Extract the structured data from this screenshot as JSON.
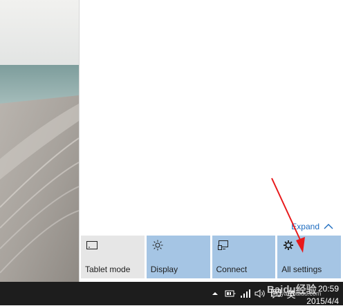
{
  "action_center": {
    "expand_label": "Expand",
    "tiles": [
      {
        "label": "Tablet mode",
        "icon": "tablet-mode-icon",
        "state": "off"
      },
      {
        "label": "Display",
        "icon": "brightness-icon",
        "state": "on"
      },
      {
        "label": "Connect",
        "icon": "connect-icon",
        "state": "on"
      },
      {
        "label": "All settings",
        "icon": "gear-icon",
        "state": "on"
      }
    ]
  },
  "taskbar": {
    "tray_icons": [
      "chevron-up-icon",
      "network-adapter-icon",
      "signal-bars-icon",
      "volume-icon",
      "action-center-icon"
    ],
    "ime_label": "英",
    "time": "20:59",
    "date": "2015/4/4"
  },
  "colors": {
    "tile_on": "#a5c5e4",
    "tile_off": "#e6e6e6",
    "accent_link": "#1c6bbf",
    "taskbar": "#1d1d1d",
    "annotation_arrow": "#e8191b"
  },
  "watermark": {
    "main": "Baidu经验",
    "sub": "jingyan.baidu.com"
  }
}
